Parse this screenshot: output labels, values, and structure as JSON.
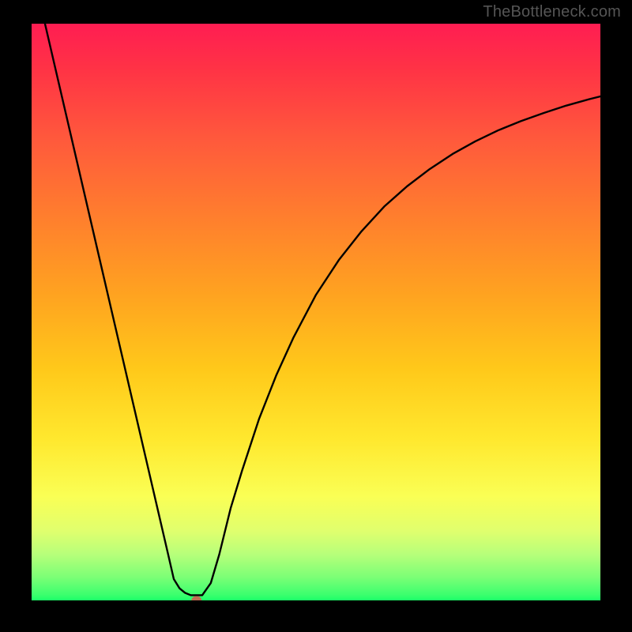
{
  "watermark": "TheBottleneck.com",
  "chart_data": {
    "type": "line",
    "title": "",
    "xlabel": "",
    "ylabel": "",
    "xlim": [
      0,
      100
    ],
    "ylim": [
      0,
      100
    ],
    "legend": false,
    "grid": false,
    "marker": {
      "x": 29,
      "y": 0,
      "color": "#d9534f"
    },
    "series": [
      {
        "name": "curve",
        "x": [
          0,
          2,
          4,
          6,
          8,
          10,
          12,
          14,
          16,
          18,
          20,
          22,
          24,
          25,
          26,
          27,
          28,
          30,
          31.5,
          33,
          35,
          37,
          40,
          43,
          46,
          50,
          54,
          58,
          62,
          66,
          70,
          74,
          78,
          82,
          86,
          90,
          94,
          98,
          100
        ],
        "y": [
          110,
          101.5,
          93,
          84.5,
          76,
          67.5,
          59,
          50.5,
          42,
          33.5,
          25,
          16.5,
          8,
          3.7,
          2.1,
          1.3,
          0.9,
          0.9,
          3,
          8,
          16,
          22.5,
          31.5,
          39,
          45.5,
          53,
          59,
          64,
          68.3,
          71.8,
          74.8,
          77.4,
          79.6,
          81.5,
          83.1,
          84.5,
          85.8,
          86.9,
          87.4
        ]
      }
    ]
  }
}
